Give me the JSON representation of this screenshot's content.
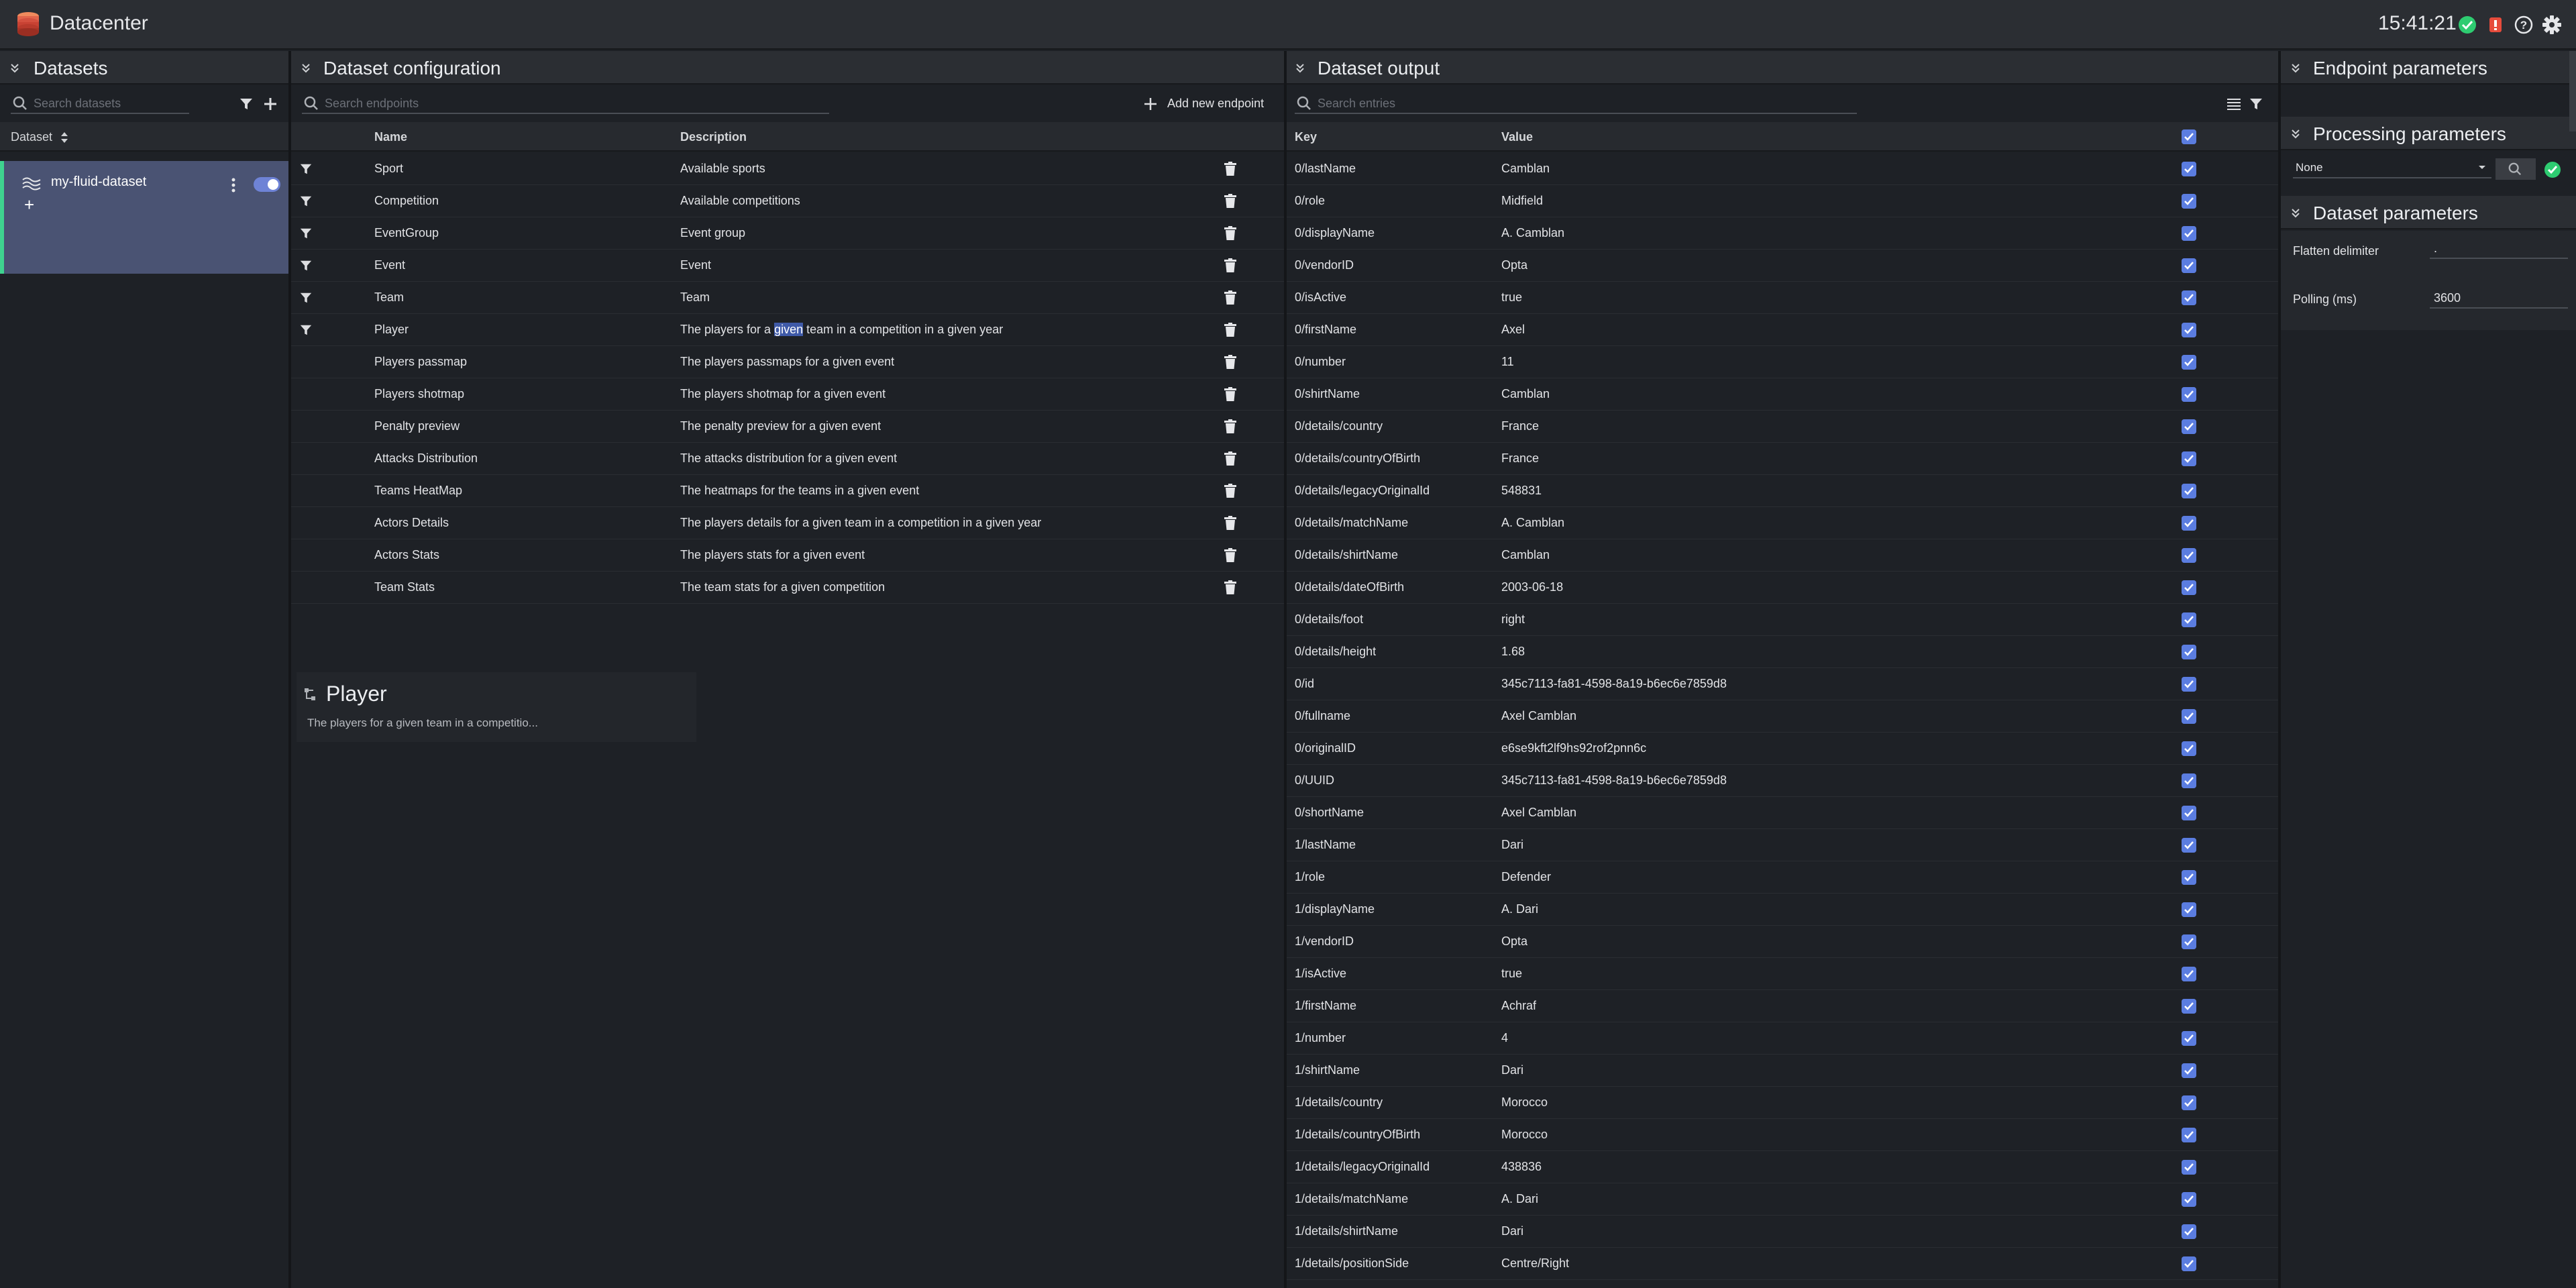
{
  "app": {
    "title": "Datacenter",
    "clock": "15:41:21"
  },
  "datasets_panel": {
    "title": "Datasets",
    "search_placeholder": "Search datasets",
    "column_header": "Dataset",
    "items": [
      {
        "name": "my-fluid-dataset",
        "enabled": true
      }
    ],
    "add_label": "+"
  },
  "config_panel": {
    "title": "Dataset configuration",
    "search_placeholder": "Search endpoints",
    "add_button_label": "Add new endpoint",
    "columns": {
      "name": "Name",
      "description": "Description"
    },
    "endpoints": [
      {
        "name": "Sport",
        "description": "Available sports",
        "filter": true
      },
      {
        "name": "Competition",
        "description": "Available competitions",
        "filter": true
      },
      {
        "name": "EventGroup",
        "description": "Event group",
        "filter": true
      },
      {
        "name": "Event",
        "description": "Event",
        "filter": true
      },
      {
        "name": "Team",
        "description": "Team",
        "filter": true
      },
      {
        "name": "Player",
        "description_pre": "The players for a ",
        "description_hl": "given",
        "description_post": " team in a competition in a given year",
        "filter": true
      },
      {
        "name": "Players passmap",
        "description": "The players passmaps for a given event",
        "filter": false
      },
      {
        "name": "Players shotmap",
        "description": "The players shotmap for a given event",
        "filter": false
      },
      {
        "name": "Penalty preview",
        "description": "The penalty preview for a given event",
        "filter": false
      },
      {
        "name": "Attacks Distribution",
        "description": "The attacks distribution for a given event",
        "filter": false
      },
      {
        "name": "Teams HeatMap",
        "description": "The heatmaps for the teams in a given event",
        "filter": false
      },
      {
        "name": "Actors Details",
        "description": "The players details for a given team in a competition in a given year",
        "filter": false
      },
      {
        "name": "Actors Stats",
        "description": "The players stats for a given event",
        "filter": false
      },
      {
        "name": "Team Stats",
        "description": "The team stats for a given competition",
        "filter": false
      }
    ],
    "detail": {
      "title": "Player",
      "description": "The players for a given team in a competitio..."
    }
  },
  "output_panel": {
    "title": "Dataset output",
    "search_placeholder": "Search entries",
    "columns": {
      "key": "Key",
      "value": "Value"
    },
    "rows": [
      {
        "key": "0/lastName",
        "value": "Camblan"
      },
      {
        "key": "0/role",
        "value": "Midfield"
      },
      {
        "key": "0/displayName",
        "value": "A. Camblan"
      },
      {
        "key": "0/vendorID",
        "value": "Opta"
      },
      {
        "key": "0/isActive",
        "value": "true"
      },
      {
        "key": "0/firstName",
        "value": "Axel"
      },
      {
        "key": "0/number",
        "value": "11"
      },
      {
        "key": "0/shirtName",
        "value": "Camblan"
      },
      {
        "key": "0/details/country",
        "value": "France"
      },
      {
        "key": "0/details/countryOfBirth",
        "value": "France"
      },
      {
        "key": "0/details/legacyOriginalId",
        "value": "548831"
      },
      {
        "key": "0/details/matchName",
        "value": "A. Camblan"
      },
      {
        "key": "0/details/shirtName",
        "value": "Camblan"
      },
      {
        "key": "0/details/dateOfBirth",
        "value": "2003-06-18"
      },
      {
        "key": "0/details/foot",
        "value": "right"
      },
      {
        "key": "0/details/height",
        "value": "1.68"
      },
      {
        "key": "0/id",
        "value": "345c7113-fa81-4598-8a19-b6ec6e7859d8"
      },
      {
        "key": "0/fullname",
        "value": "Axel Camblan"
      },
      {
        "key": "0/originalID",
        "value": "e6se9kft2lf9hs92rof2pnn6c"
      },
      {
        "key": "0/UUID",
        "value": "345c7113-fa81-4598-8a19-b6ec6e7859d8"
      },
      {
        "key": "0/shortName",
        "value": "Axel Camblan"
      },
      {
        "key": "1/lastName",
        "value": "Dari"
      },
      {
        "key": "1/role",
        "value": "Defender"
      },
      {
        "key": "1/displayName",
        "value": "A. Dari"
      },
      {
        "key": "1/vendorID",
        "value": "Opta"
      },
      {
        "key": "1/isActive",
        "value": "true"
      },
      {
        "key": "1/firstName",
        "value": "Achraf"
      },
      {
        "key": "1/number",
        "value": "4"
      },
      {
        "key": "1/shirtName",
        "value": "Dari"
      },
      {
        "key": "1/details/country",
        "value": "Morocco"
      },
      {
        "key": "1/details/countryOfBirth",
        "value": "Morocco"
      },
      {
        "key": "1/details/legacyOriginalId",
        "value": "438836"
      },
      {
        "key": "1/details/matchName",
        "value": "A. Dari"
      },
      {
        "key": "1/details/shirtName",
        "value": "Dari"
      },
      {
        "key": "1/details/positionSide",
        "value": "Centre/Right"
      }
    ]
  },
  "params_panel": {
    "endpoint_title": "Endpoint parameters",
    "processing_title": "Processing parameters",
    "processing_select_value": "None",
    "dataset_title": "Dataset parameters",
    "flatten_label": "Flatten delimiter",
    "flatten_value": ".",
    "polling_label": "Polling (ms)",
    "polling_value": "3600"
  },
  "colors": {
    "accent": "#5b7de0",
    "ok": "#2ecc71",
    "error": "#e74c3c",
    "selected_bg": "#4a5373"
  }
}
